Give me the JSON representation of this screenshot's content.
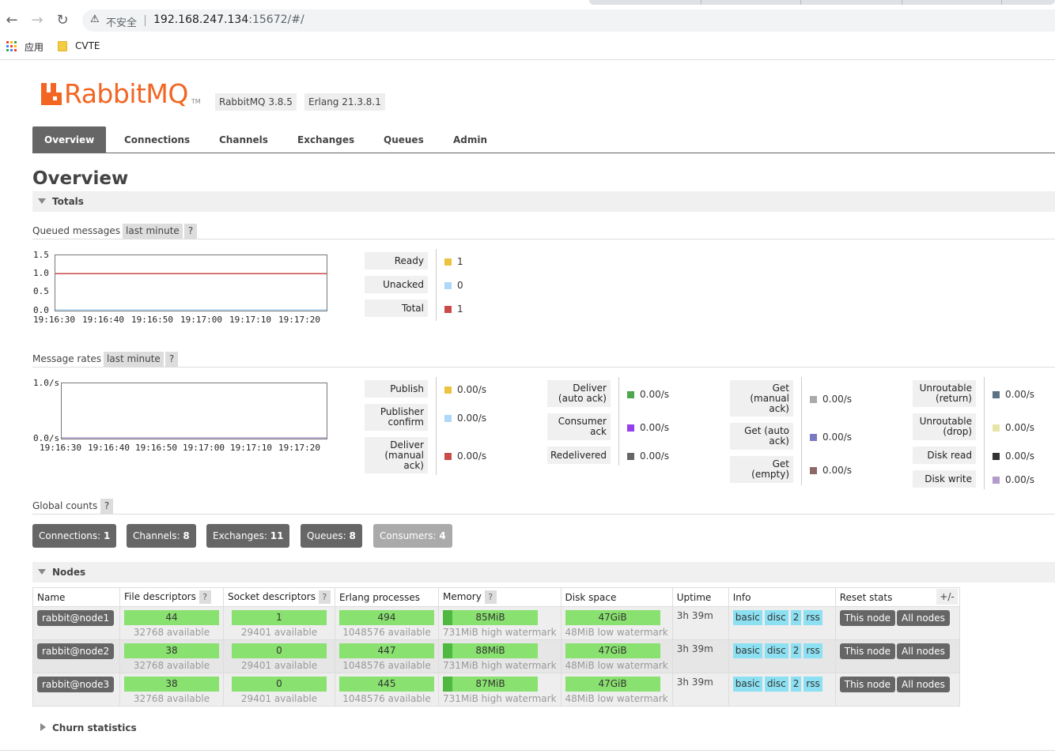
{
  "browser": {
    "security_label": "不安全",
    "url_host": "192.168.247.134",
    "url_rest": ":15672/#/",
    "bookmarks": [
      {
        "label": "应用",
        "icon": "apps-grid-icon"
      },
      {
        "label": "CVTE",
        "icon": "folder-icon"
      }
    ]
  },
  "header": {
    "logo_text": "RabbitMQ",
    "logo_tm": "TM",
    "rabbitmq_version": "RabbitMQ 3.8.5",
    "erlang_version": "Erlang 21.3.8.1",
    "brand_color": "#f26522"
  },
  "nav": {
    "tabs": [
      "Overview",
      "Connections",
      "Channels",
      "Exchanges",
      "Queues",
      "Admin"
    ],
    "active": "Overview"
  },
  "page_title": "Overview",
  "totals": {
    "label": "Totals",
    "queued": {
      "label": "Queued messages",
      "range": "last minute",
      "help": "?",
      "y_ticks": [
        "1.5",
        "1.0",
        "0.5",
        "0.0"
      ],
      "x_ticks": [
        "19:16:30",
        "19:16:40",
        "19:16:50",
        "19:17:00",
        "19:17:10",
        "19:17:20"
      ],
      "legend": [
        {
          "label": "Ready",
          "value": "1",
          "color": "#edc240"
        },
        {
          "label": "Unacked",
          "value": "0",
          "color": "#afd8f8"
        },
        {
          "label": "Total",
          "value": "1",
          "color": "#cb4b4b"
        }
      ]
    },
    "rates": {
      "label": "Message rates",
      "range": "last minute",
      "help": "?",
      "y_ticks": [
        "1.0/s",
        "0.0/s"
      ],
      "x_ticks": [
        "19:16:30",
        "19:16:40",
        "19:16:50",
        "19:17:00",
        "19:17:10",
        "19:17:20"
      ],
      "legend_columns": [
        [
          {
            "label": "Publish",
            "value": "0.00/s",
            "color": "#edc240"
          },
          {
            "label": "Publisher confirm",
            "value": "0.00/s",
            "color": "#afd8f8"
          },
          {
            "label": "Deliver (manual ack)",
            "value": "0.00/s",
            "color": "#cb4b4b"
          }
        ],
        [
          {
            "label": "Deliver (auto ack)",
            "value": "0.00/s",
            "color": "#4da74d"
          },
          {
            "label": "Consumer ack",
            "value": "0.00/s",
            "color": "#9440ed"
          },
          {
            "label": "Redelivered",
            "value": "0.00/s",
            "color": "#666666"
          }
        ],
        [
          {
            "label": "Get (manual ack)",
            "value": "0.00/s",
            "color": "#aaaaaa"
          },
          {
            "label": "Get (auto ack)",
            "value": "0.00/s",
            "color": "#7c79c3"
          },
          {
            "label": "Get (empty)",
            "value": "0.00/s",
            "color": "#8e6767"
          }
        ],
        [
          {
            "label": "Unroutable (return)",
            "value": "0.00/s",
            "color": "#5d7282"
          },
          {
            "label": "Unroutable (drop)",
            "value": "0.00/s",
            "color": "#e8e4a8"
          },
          {
            "label": "Disk read",
            "value": "0.00/s",
            "color": "#333333"
          },
          {
            "label": "Disk write",
            "value": "0.00/s",
            "color": "#b39bcb"
          }
        ]
      ]
    },
    "global_counts": {
      "label": "Global counts",
      "help": "?",
      "items": [
        {
          "label": "Connections:",
          "value": "1"
        },
        {
          "label": "Channels:",
          "value": "8"
        },
        {
          "label": "Exchanges:",
          "value": "11"
        },
        {
          "label": "Queues:",
          "value": "8"
        },
        {
          "label": "Consumers:",
          "value": "4"
        }
      ]
    }
  },
  "chart_data": [
    {
      "type": "line",
      "title": "Queued messages",
      "x": [
        "19:16:30",
        "19:16:40",
        "19:16:50",
        "19:17:00",
        "19:17:10",
        "19:17:20"
      ],
      "ylim": [
        0,
        1.5
      ],
      "series": [
        {
          "name": "Ready",
          "values": [
            1,
            1,
            1,
            1,
            1,
            1
          ],
          "color": "#edc240"
        },
        {
          "name": "Unacked",
          "values": [
            0,
            0,
            0,
            0,
            0,
            0
          ],
          "color": "#afd8f8"
        },
        {
          "name": "Total",
          "values": [
            1,
            1,
            1,
            1,
            1,
            1
          ],
          "color": "#cb4b4b"
        }
      ]
    },
    {
      "type": "line",
      "title": "Message rates",
      "x": [
        "19:16:30",
        "19:16:40",
        "19:16:50",
        "19:17:00",
        "19:17:10",
        "19:17:20"
      ],
      "ylim": [
        0,
        1.0
      ],
      "series": [
        {
          "name": "Disk write",
          "values": [
            0,
            0,
            0,
            0,
            0,
            0
          ],
          "color": "#b39bcb"
        }
      ]
    }
  ],
  "nodes": {
    "label": "Nodes",
    "plus_minus": "+/-",
    "columns": [
      "Name",
      "File descriptors",
      "Socket descriptors",
      "Erlang processes",
      "Memory",
      "Disk space",
      "Uptime",
      "Info",
      "Reset stats"
    ],
    "help": "?",
    "rows": [
      {
        "name": "rabbit@node1",
        "fd": "44",
        "fd_avail": "32768 available",
        "sockets": "1",
        "sockets_avail": "29401 available",
        "procs": "494",
        "procs_avail": "1048576 available",
        "memory": "85MiB",
        "memory_note": "731MiB high watermark",
        "disk": "47GiB",
        "disk_note": "48MiB low watermark",
        "uptime": "3h 39m",
        "info": [
          "basic",
          "disc",
          "2",
          "rss"
        ],
        "reset": [
          "This node",
          "All nodes"
        ]
      },
      {
        "name": "rabbit@node2",
        "fd": "38",
        "fd_avail": "32768 available",
        "sockets": "0",
        "sockets_avail": "29401 available",
        "procs": "447",
        "procs_avail": "1048576 available",
        "memory": "88MiB",
        "memory_note": "731MiB high watermark",
        "disk": "47GiB",
        "disk_note": "48MiB low watermark",
        "uptime": "3h 39m",
        "info": [
          "basic",
          "disc",
          "2",
          "rss"
        ],
        "reset": [
          "This node",
          "All nodes"
        ]
      },
      {
        "name": "rabbit@node3",
        "fd": "38",
        "fd_avail": "32768 available",
        "sockets": "0",
        "sockets_avail": "29401 available",
        "procs": "445",
        "procs_avail": "1048576 available",
        "memory": "87MiB",
        "memory_note": "731MiB high watermark",
        "disk": "47GiB",
        "disk_note": "48MiB low watermark",
        "uptime": "3h 39m",
        "info": [
          "basic",
          "disc",
          "2",
          "rss"
        ],
        "reset": [
          "This node",
          "All nodes"
        ]
      }
    ]
  },
  "churn": {
    "label": "Churn statistics"
  }
}
